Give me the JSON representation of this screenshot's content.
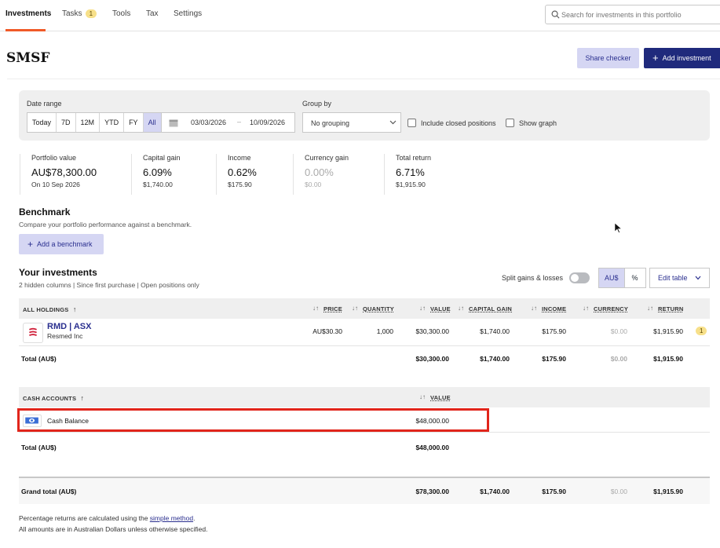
{
  "nav": {
    "tabs": [
      {
        "label": "Investments"
      },
      {
        "label": "Tasks",
        "badge": "1"
      },
      {
        "label": "Tools"
      },
      {
        "label": "Tax"
      },
      {
        "label": "Settings"
      }
    ],
    "search_placeholder": "Search for investments in this portfolio"
  },
  "header": {
    "title": "SMSF",
    "share_label": "Share checker",
    "add_label": "Add investment"
  },
  "filters": {
    "date_range_label": "Date range",
    "range_options": [
      "Today",
      "7D",
      "12M",
      "YTD",
      "FY",
      "All"
    ],
    "active_range": "All",
    "date_from": "03/03/2026",
    "date_separator": "–",
    "date_to": "10/09/2026",
    "group_by_label": "Group by",
    "group_by_value": "No grouping",
    "include_closed_label": "Include closed positions",
    "show_graph_label": "Show graph"
  },
  "stats": [
    {
      "heading": "Portfolio value",
      "value": "AU$78,300.00",
      "sub": "On 10 Sep 2026"
    },
    {
      "heading": "Capital gain",
      "value": "6.09%",
      "sub": "$1,740.00"
    },
    {
      "heading": "Income",
      "value": "0.62%",
      "sub": "$175.90"
    },
    {
      "heading": "Currency gain",
      "value": "0.00%",
      "sub": "$0.00"
    },
    {
      "heading": "Total return",
      "value": "6.71%",
      "sub": "$1,915.90"
    }
  ],
  "benchmark": {
    "title": "Benchmark",
    "subtitle": "Compare your portfolio performance against a benchmark.",
    "button_label": "Add a benchmark"
  },
  "investments": {
    "title": "Your investments",
    "subtitle": "2 hidden columns | Since first purchase | Open positions only",
    "split_label": "Split gains & losses",
    "unit_options": [
      "AU$",
      "%"
    ],
    "edit_table_label": "Edit table",
    "holdings_header": {
      "name": "ALL HOLDINGS",
      "price": "PRICE",
      "quantity": "QUANTITY",
      "value": "VALUE",
      "capital_gain": "CAPITAL GAIN",
      "income": "INCOME",
      "currency": "CURRENCY",
      "return": "RETURN"
    },
    "holdings": [
      {
        "code": "RMD | ASX",
        "name": "Resmed Inc",
        "price": "AU$30.30",
        "quantity": "1,000",
        "value": "$30,300.00",
        "capital_gain": "$1,740.00",
        "income": "$175.90",
        "currency": "$0.00",
        "return": "$1,915.90",
        "badge": "1"
      }
    ],
    "holdings_total": {
      "label": "Total (AU$)",
      "value": "$30,300.00",
      "capital_gain": "$1,740.00",
      "income": "$175.90",
      "currency": "$0.00",
      "return": "$1,915.90"
    },
    "cash_header": {
      "name": "CASH ACCOUNTS",
      "value": "VALUE"
    },
    "cash": [
      {
        "name": "Cash Balance",
        "value": "$48,000.00"
      }
    ],
    "cash_total": {
      "label": "Total (AU$)",
      "value": "$48,000.00"
    },
    "grand_total": {
      "label": "Grand total (AU$)",
      "value": "$78,300.00",
      "capital_gain": "$1,740.00",
      "income": "$175.90",
      "currency": "$0.00",
      "return": "$1,915.90"
    }
  },
  "footer": {
    "line1_prefix": "Percentage returns are calculated using the ",
    "line1_link": "simple method",
    "line1_suffix": ".",
    "line2": "All amounts are in Australian Dollars unless otherwise specified."
  },
  "colors": {
    "accent": "#1f2a7c",
    "accent_light": "#d5d6f3",
    "tab_underline": "#f05a28",
    "highlight": "#e1251b"
  }
}
